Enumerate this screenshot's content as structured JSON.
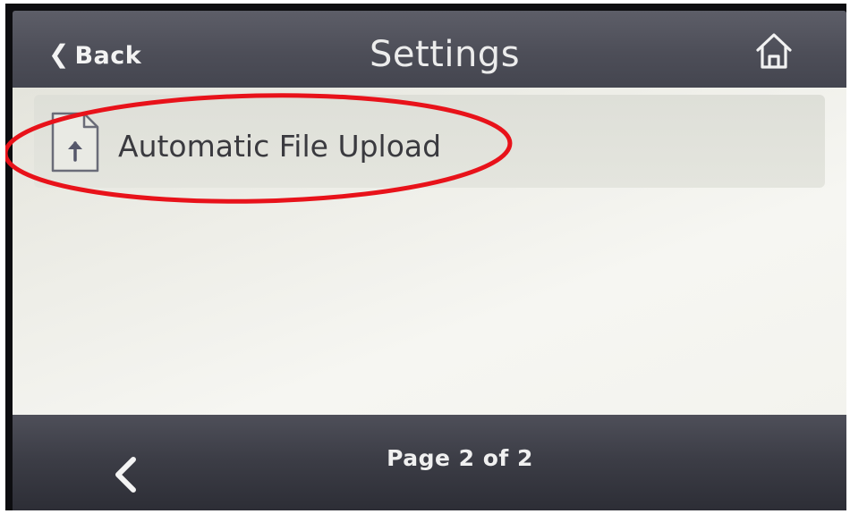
{
  "header": {
    "back_label": "Back",
    "title": "Settings",
    "home_icon": "home-icon"
  },
  "menu": {
    "items": [
      {
        "label": "Automatic File Upload",
        "icon": "file-upload-icon",
        "highlighted": true
      }
    ]
  },
  "annotation": {
    "shape": "ellipse",
    "color": "#e8121a",
    "target": "Automatic File Upload"
  },
  "footer": {
    "page_indicator": "Page 2 of 2",
    "prev_icon": "chevron-left-icon"
  },
  "colors": {
    "header_bg": "#4d4e58",
    "footer_bg": "#3c3d46",
    "content_bg": "#eeeee8",
    "menu_text": "#3a3a3f",
    "annotation": "#e8121a"
  }
}
